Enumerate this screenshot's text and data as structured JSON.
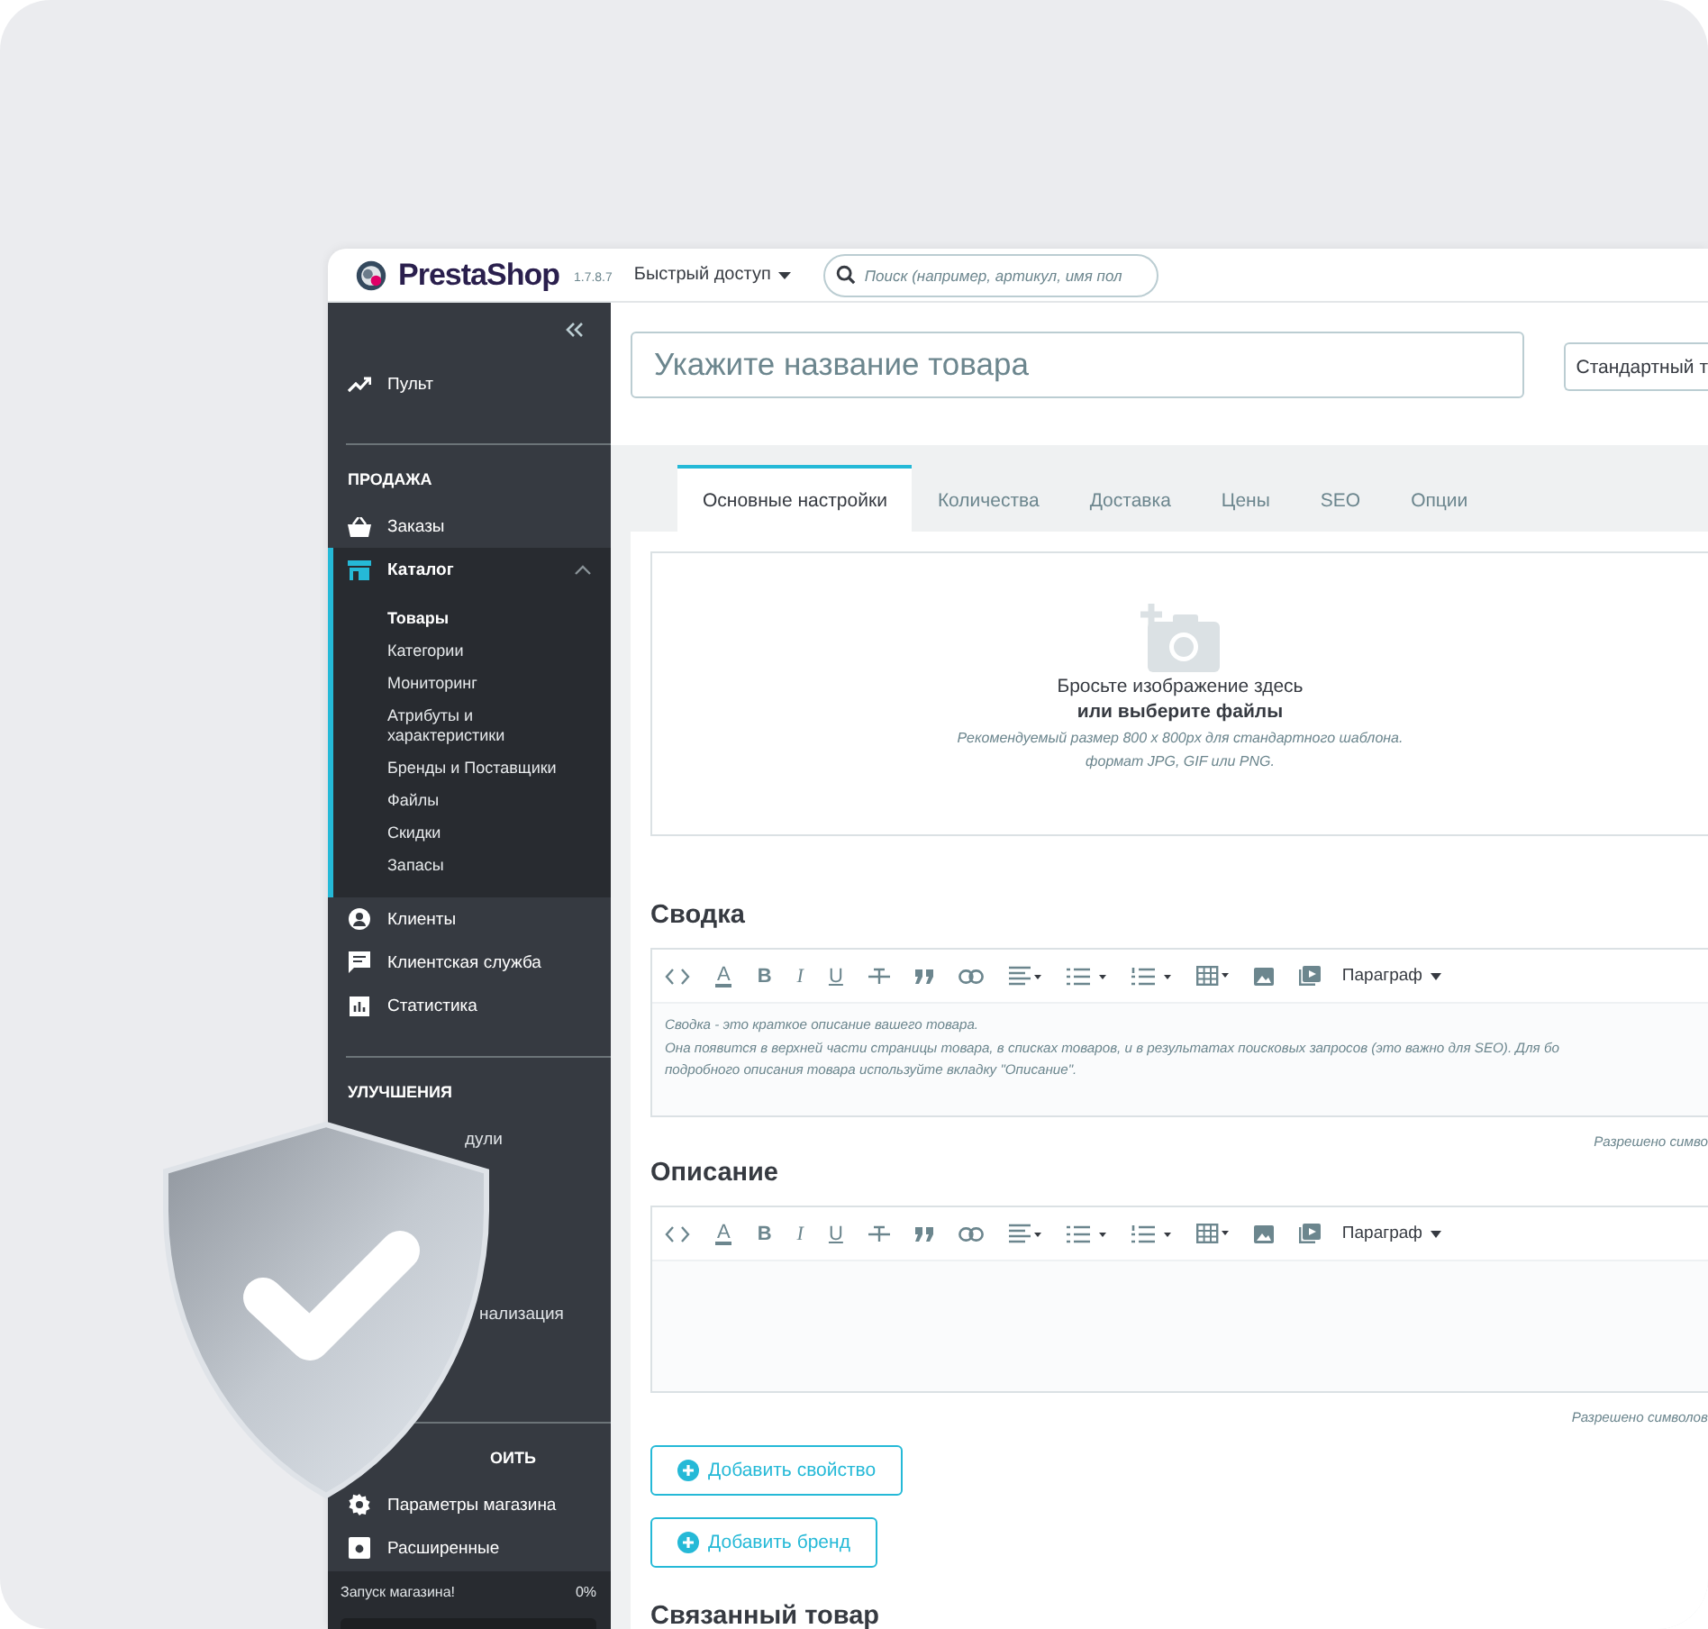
{
  "header": {
    "logo": "PrestaShop",
    "version": "1.7.8.7",
    "quick_access": "Быстрый доступ",
    "search": {
      "placeholder": "Поиск (например, артикул, имя пол"
    }
  },
  "sidebar": {
    "groups": [
      {
        "items": [
          {
            "kind": "dashboard",
            "label": "Пульт",
            "selected": false
          }
        ]
      },
      {
        "heading": "ПРОДАЖА",
        "items": [
          {
            "kind": "orders",
            "label": "Заказы",
            "selected": false
          },
          {
            "kind": "catalog",
            "label": "Каталог",
            "selected": true,
            "expanded": true,
            "children": [
              {
                "label": "Товары",
                "selected": true
              },
              {
                "label": "Категории",
                "selected": false
              },
              {
                "label": "Мониторинг",
                "selected": false
              },
              {
                "label": "Атрибуты и характеристики",
                "selected": false
              },
              {
                "label": "Бренды и Поставщики",
                "selected": false
              },
              {
                "label": "Файлы",
                "selected": false
              },
              {
                "label": "Скидки",
                "selected": false
              },
              {
                "label": "Запасы",
                "selected": false
              }
            ]
          },
          {
            "kind": "customers",
            "label": "Клиенты",
            "selected": false
          },
          {
            "kind": "service",
            "label": "Клиентская служба",
            "selected": false
          },
          {
            "kind": "stats",
            "label": "Статистика",
            "selected": false
          }
        ]
      },
      {
        "heading": "УЛУЧШЕНИЯ",
        "items": [
          {
            "kind": "partial",
            "label": "дули",
            "selected": false
          },
          {
            "kind": "partial",
            "label": "нализация",
            "selected": false
          }
        ]
      },
      {
        "heading": "ОИТЬ",
        "heading_cut": true,
        "items": [
          {
            "kind": "settings",
            "label": "Параметры магазина",
            "selected": false
          },
          {
            "kind": "advanced",
            "label": "Расширенные",
            "selected": false
          }
        ]
      }
    ]
  },
  "launch": {
    "label": "Запуск магазина!",
    "reading": "0%",
    "level": 0
  },
  "product": {
    "name_placeholder": "Укажите название товара",
    "type": "Стандартный т"
  },
  "tabs": [
    {
      "label": "Основные настройки",
      "selected": true
    },
    {
      "label": "Количества",
      "selected": false
    },
    {
      "label": "Доставка",
      "selected": false
    },
    {
      "label": "Цены",
      "selected": false
    },
    {
      "label": "SEO",
      "selected": false
    },
    {
      "label": "Опции",
      "selected": false
    }
  ],
  "dropzone": {
    "title": "Бросьте изображение здесь",
    "link": "или выберите файлы",
    "hints": [
      "Рекомендуемый размер 800 x 800px для стандартного шаблона.",
      "формат JPG, GIF или PNG."
    ]
  },
  "editors": [
    {
      "title": "Сводка",
      "toolbar": {
        "text_color": "A",
        "bold": "B",
        "italic": "I",
        "underline": "U",
        "format": "Параграф"
      },
      "placeholder_lines": [
        "Сводка - это краткое описание вашего товара.",
        "Она появится в верхней части страницы товара, в списках товаров, и в результатах поисковых запросов (это важно для SEO). Для бо",
        "подробного описания товара используйте вкладку \"Описание\"."
      ],
      "counter": "Разрешено симво"
    },
    {
      "title": "Описание",
      "toolbar": {
        "text_color": "A",
        "bold": "B",
        "italic": "I",
        "underline": "U",
        "format": "Параграф"
      },
      "counter": "Разрешено символов"
    }
  ],
  "buttons": [
    "Добавить свойство",
    "Добавить бренд"
  ],
  "related_heading": "Связанный товар"
}
